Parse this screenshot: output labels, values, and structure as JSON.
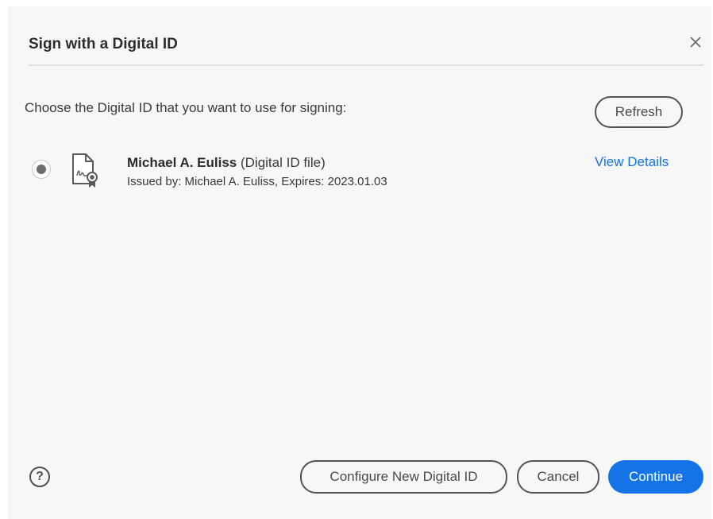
{
  "dialog": {
    "title": "Sign with a Digital ID",
    "close_icon": "close-icon",
    "prompt": "Choose the Digital ID that you want to use for signing:",
    "refresh_label": "Refresh"
  },
  "digital_id": {
    "selected": true,
    "icon": "certificate-file-icon",
    "name": "Michael A. Euliss",
    "type": "(Digital ID file)",
    "issued": "Issued by: Michael A. Euliss, Expires: 2023.01.03",
    "view_details_label": "View Details"
  },
  "footer": {
    "help_icon": "help-icon",
    "help_glyph": "?",
    "configure_label": "Configure New Digital ID",
    "cancel_label": "Cancel",
    "continue_label": "Continue"
  },
  "colors": {
    "accent": "#1473e6",
    "background": "#f7f7f7",
    "text": "#3a3a3a"
  }
}
